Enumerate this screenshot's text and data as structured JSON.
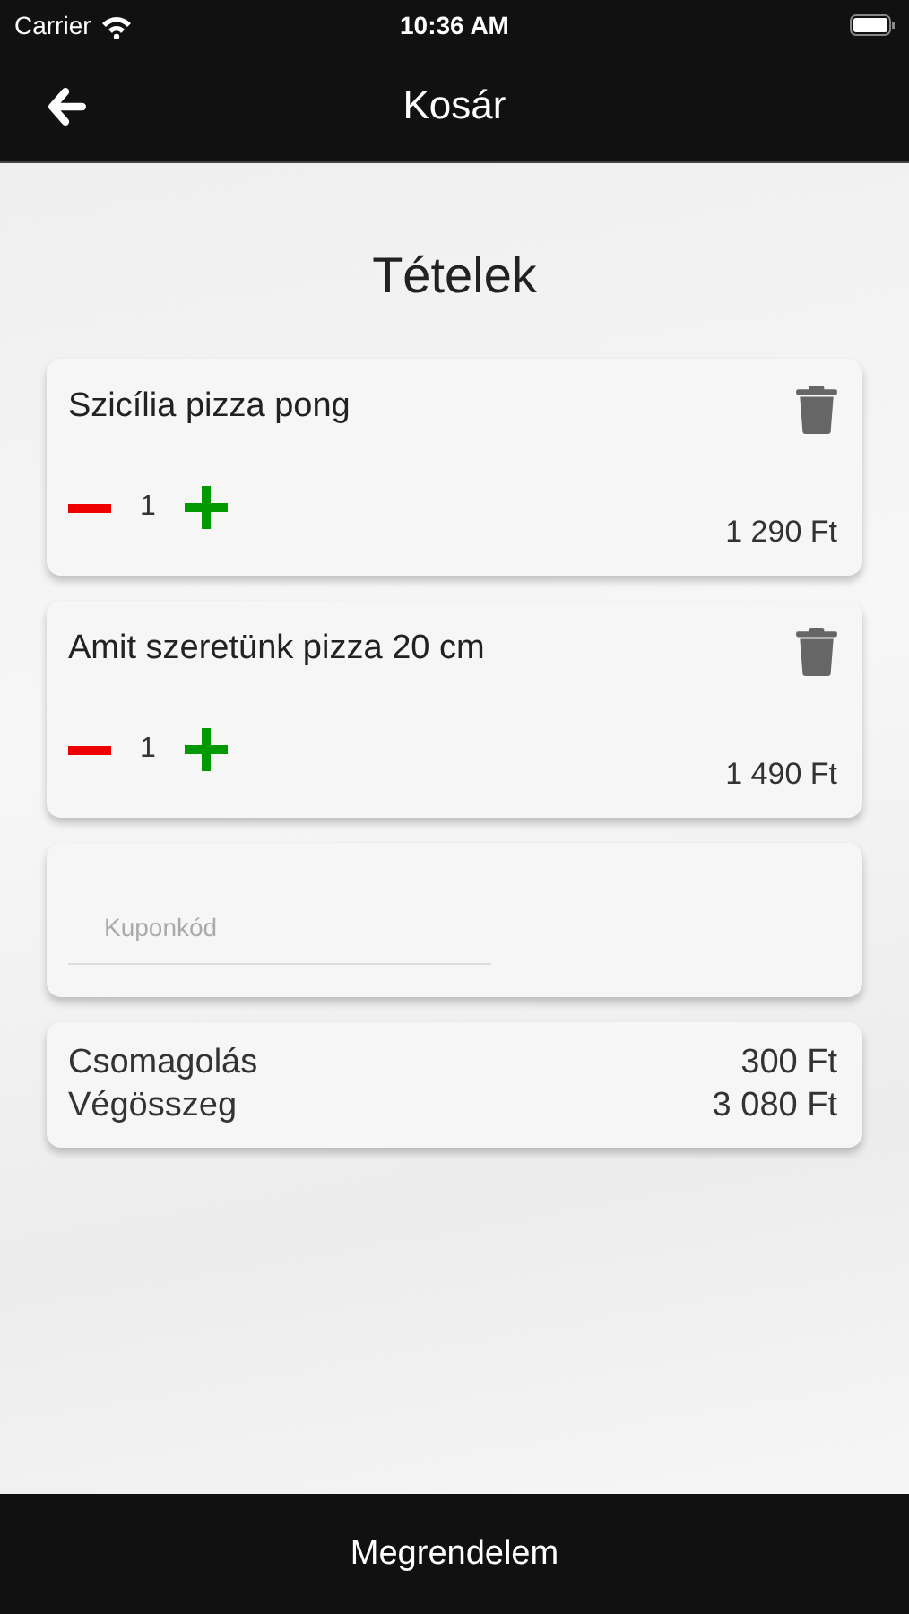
{
  "status_bar": {
    "carrier": "Carrier",
    "time": "10:36 AM"
  },
  "nav": {
    "title": "Kosár"
  },
  "heading": "Tételek",
  "items": [
    {
      "name": "Szicília pizza pong",
      "quantity": "1",
      "price": "1 290 Ft"
    },
    {
      "name": "Amit szeretünk pizza 20 cm",
      "quantity": "1",
      "price": "1 490 Ft"
    }
  ],
  "coupon": {
    "placeholder": "Kuponkód"
  },
  "summary": [
    {
      "label": "Csomagolás",
      "value": "300 Ft"
    },
    {
      "label": "Végösszeg",
      "value": "3 080 Ft"
    }
  ],
  "order_button": "Megrendelem"
}
